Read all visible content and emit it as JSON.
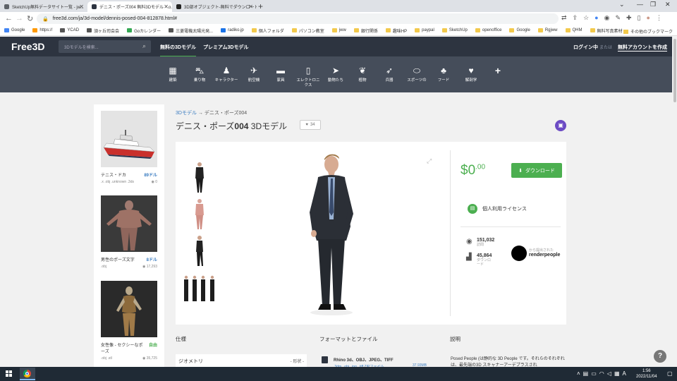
{
  "browser": {
    "tabs": [
      {
        "title": "SketchUp無料データサイト一覧 - jw...",
        "active": false,
        "favicon_color": "#5f6368"
      },
      {
        "title": "デニス・ポーズ004 無料3Dモデル - .o...",
        "active": true,
        "favicon_color": "#2d3440"
      },
      {
        "title": "3D部オブジェクト-無料でダウンロードPT...",
        "active": false,
        "favicon_color": "#222"
      }
    ],
    "new_tab": "+",
    "url": "free3d.com/ja/3d-model/dennis-posed-004-812878.html#",
    "bookmarks": [
      "Google",
      "https://",
      "YCAD",
      "須ヶ丘司会会",
      "Goカレンダー",
      "三菱電機太陽光発...",
      "radiko.jp",
      "個人フォルダ",
      "パソコン教室",
      "jww",
      "銀行関係",
      "趣味HP",
      "paypal",
      "SketchUp",
      "openoffice",
      "Google",
      "Rgjww",
      "QHM",
      "無料写真素材"
    ],
    "other_bookmarks": "その他のブックマーク"
  },
  "site": {
    "logo": "Free3D",
    "search_placeholder": "3Dモデルを検索...",
    "nav": [
      {
        "label": "無料の3Dモデル",
        "active": true
      },
      {
        "label": "プレミアム3Dモデル",
        "active": false
      }
    ],
    "login": "ログイン中",
    "or": "または",
    "signup": "無料アカウントを作成",
    "categories": [
      {
        "icon": "building-icon",
        "glyph": "▦",
        "label": "建築"
      },
      {
        "icon": "car-icon",
        "glyph": "🚗",
        "label": "乗り物"
      },
      {
        "icon": "character-icon",
        "glyph": "👥",
        "label": "キャラクター"
      },
      {
        "icon": "airplane-icon",
        "glyph": "✈",
        "label": "航空機"
      },
      {
        "icon": "furniture-icon",
        "glyph": "🛋",
        "label": "家具"
      },
      {
        "icon": "phone-icon",
        "glyph": "📱",
        "label": "エレクトロニクス"
      },
      {
        "icon": "animal-icon",
        "glyph": "🐟",
        "label": "動物たち"
      },
      {
        "icon": "plant-icon",
        "glyph": "🌿",
        "label": "植物"
      },
      {
        "icon": "weapon-icon",
        "glyph": "🚀",
        "label": "兵器"
      },
      {
        "icon": "sports-icon",
        "glyph": "🏈",
        "label": "スポーツの"
      },
      {
        "icon": "food-icon",
        "glyph": "🍄",
        "label": "フード"
      },
      {
        "icon": "anatomy-icon",
        "glyph": "🦷",
        "label": "解剖学"
      },
      {
        "icon": "plus-icon",
        "glyph": "+",
        "label": ""
      }
    ]
  },
  "sidebar": {
    "items": [
      {
        "name": "テニス・ドカ",
        "price": "89ドル",
        "free": false,
        "formats": ".x .obj .unknown .3ds",
        "views": "0"
      },
      {
        "name": "男性のポーズ文字",
        "price": "8ドル",
        "free": false,
        "formats": ".obj",
        "views": "17,293"
      },
      {
        "name": "女性像 - セクシーなポーズ",
        "price": "自由",
        "free": true,
        "formats": ".obj .stl",
        "views": "35,725"
      }
    ]
  },
  "product": {
    "breadcrumb_root": "3Dモデル",
    "breadcrumb_sep": "→",
    "breadcrumb_current": "デニス・ポーズ004",
    "title_prefix": "デニス・ポーズ",
    "title_num": "004",
    "title_suffix": " 3Dモデル",
    "likes": "34",
    "price_int": "0",
    "price_dec": ".00",
    "currency": "$",
    "download_label": "ダウンロード",
    "license_label": "個人利用ライセンス",
    "views_num": "151,032",
    "views_label": "訪問",
    "downloads_num": "45,864",
    "downloads_label": "ダウンロード",
    "author_by": "から提出された",
    "author_name": "renderpeople"
  },
  "details": {
    "spec_head": "仕様",
    "geometry_label": "ジオメトリ",
    "geometry_value": "- 形状 -",
    "formats_head": "フォーマットとファイル",
    "formats_main": "Rhino 3d、OBJ、JPEG、TIFF",
    "formats_sub": ".3dm, .obj, .jpg, .tiff ZIPファイル",
    "formats_size": "37.93MB",
    "desc_head": "説明",
    "desc_text": "Posed People (は静的な 3D People です。それらのそれぞれは、最先端の3D スキャナーアーデプラスされ"
  },
  "taskbar": {
    "time": "1:56",
    "date": "2022/11/04"
  },
  "colors": {
    "accent_green": "#4caf50",
    "header_dark": "#2d3440",
    "category_bar": "#454d5a",
    "link_blue": "#3a7cc1"
  }
}
